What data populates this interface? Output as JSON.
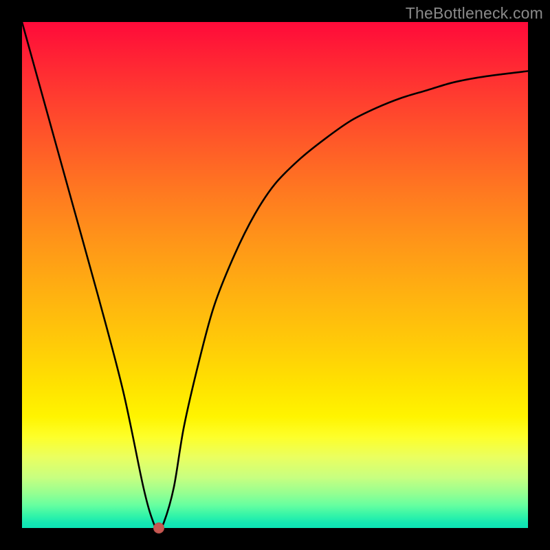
{
  "watermark": "TheBottleneck.com",
  "colors": {
    "frame": "#000000",
    "curve": "#000000",
    "marker": "#c85852"
  },
  "chart_data": {
    "type": "line",
    "title": "",
    "xlabel": "",
    "ylabel": "",
    "xlim": [
      0,
      100
    ],
    "ylim": [
      0,
      100
    ],
    "grid": false,
    "series": [
      {
        "name": "bottleneck-curve",
        "x": [
          0,
          5,
          10,
          15,
          20,
          24,
          26,
          27,
          28,
          30,
          32,
          35,
          38,
          42,
          46,
          50,
          55,
          60,
          65,
          70,
          75,
          80,
          85,
          90,
          95,
          100
        ],
        "values": [
          100,
          82,
          64,
          46,
          27,
          8,
          1,
          0,
          1,
          8,
          20,
          33,
          44,
          54,
          62,
          68,
          73,
          77,
          80.5,
          83,
          85,
          86.5,
          88,
          89,
          89.7,
          90.3
        ]
      }
    ],
    "marker": {
      "x": 27,
      "y": 0
    },
    "background_gradient": {
      "top": "#ff0a3a",
      "bottom": "#0de3b5"
    }
  }
}
